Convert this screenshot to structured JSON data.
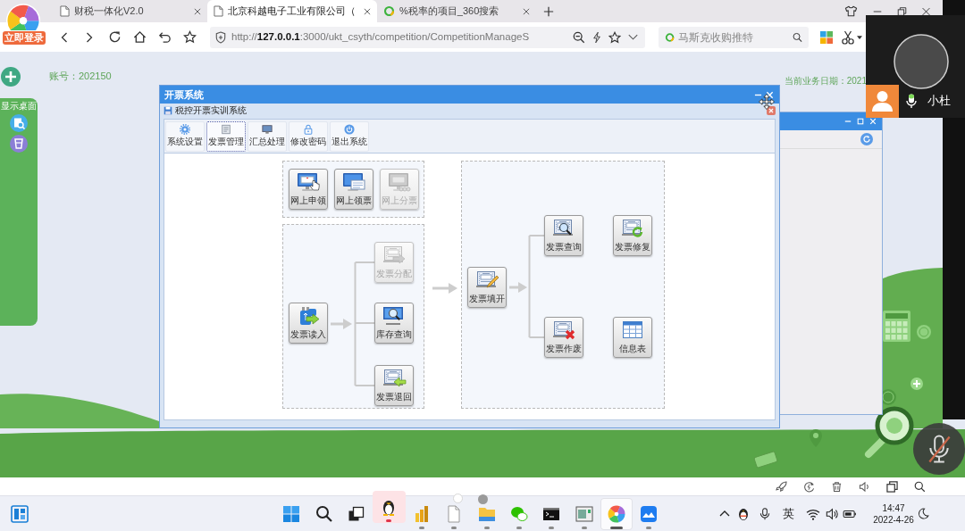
{
  "browser": {
    "login_badge": "立即登录",
    "tabs": [
      {
        "kind": "page",
        "title": "财税一体化V2.0",
        "selected": false
      },
      {
        "kind": "page",
        "title": "北京科越电子工业有限公司（",
        "selected": true
      },
      {
        "kind": "search",
        "title": "%税率的项目_360搜索",
        "selected": false
      }
    ],
    "address": "http://**127.0.0.1**:3000/ukt_csyth/competition/CompetitionManageS",
    "search": {
      "placeholder": "马斯克收购推特"
    }
  },
  "page": {
    "account": "账号：202150",
    "business_date": "当前业务日期：2021",
    "sidebar": {
      "title": "显示桌面"
    }
  },
  "dialog": {
    "title": "开票系统",
    "subtitle": "税控开票实训系统",
    "toolbar": [
      {
        "label": "系统设置",
        "selected": false
      },
      {
        "label": "发票管理",
        "selected": true
      },
      {
        "label": "汇总处理",
        "selected": false
      },
      {
        "label": "修改密码",
        "selected": false
      },
      {
        "label": "退出系统",
        "selected": false
      }
    ],
    "online": [
      {
        "label": "网上申领",
        "disabled": false
      },
      {
        "label": "网上领票",
        "disabled": false
      },
      {
        "label": "网上分票",
        "disabled": true
      }
    ],
    "stock": {
      "source": {
        "label": "发票读入",
        "disabled": false
      },
      "branches": [
        {
          "label": "发票分配",
          "disabled": true
        },
        {
          "label": "库存查询",
          "disabled": false
        },
        {
          "label": "发票退回",
          "disabled": false
        }
      ]
    },
    "issuing": {
      "source": {
        "label": "发票填开",
        "disabled": false
      },
      "branches": [
        {
          "label": "发票查询",
          "disabled": false
        },
        {
          "label": "发票作废",
          "disabled": false
        }
      ],
      "extras": [
        {
          "label": "发票修复",
          "disabled": false
        },
        {
          "label": "信息表",
          "disabled": false
        }
      ]
    }
  },
  "video_call": {
    "participant": "小杜"
  },
  "taskbar": {
    "apps": [
      {
        "kind": "penguin",
        "selected": false,
        "alert": true
      },
      {
        "kind": "chart",
        "selected": false,
        "alert": false
      },
      {
        "kind": "document",
        "selected": false,
        "alert": false
      },
      {
        "kind": "folder",
        "selected": false,
        "alert": false
      },
      {
        "kind": "chat",
        "selected": false,
        "alert": false
      },
      {
        "kind": "terminal",
        "selected": false,
        "alert": false
      },
      {
        "kind": "window",
        "selected": false,
        "alert": false
      },
      {
        "kind": "browser",
        "selected": true,
        "alert": false
      },
      {
        "kind": "meeting",
        "selected": false,
        "alert": false
      }
    ],
    "ime": "英",
    "time": "14:47",
    "date": "2022-4-26"
  }
}
